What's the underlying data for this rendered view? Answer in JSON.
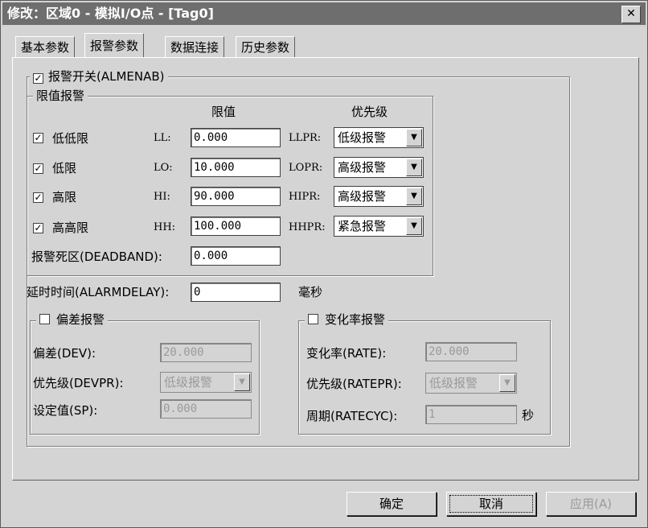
{
  "window": {
    "title": "修改：区域0 - 模拟I/O点 - [Tag0]",
    "close": "✕"
  },
  "tabs": [
    "基本参数",
    "报警参数",
    "数据连接",
    "历史参数"
  ],
  "alarm_switch": {
    "label": "报警开关(ALMENAB)",
    "checked": "✓"
  },
  "limit_group": {
    "title": "限值报警",
    "col_limit": "限值",
    "col_priority": "优先级",
    "rows": [
      {
        "check": "✓",
        "name": "低低限",
        "code": "LL:",
        "value": "0.000",
        "pr_code": "LLPR:",
        "priority": "低级报警"
      },
      {
        "check": "✓",
        "name": "低限",
        "code": "LO:",
        "value": "10.000",
        "pr_code": "LOPR:",
        "priority": "高级报警"
      },
      {
        "check": "✓",
        "name": "高限",
        "code": "HI:",
        "value": "90.000",
        "pr_code": "HIPR:",
        "priority": "高级报警"
      },
      {
        "check": "✓",
        "name": "高高限",
        "code": "HH:",
        "value": "100.000",
        "pr_code": "HHPR:",
        "priority": "紧急报警"
      }
    ],
    "deadband_label": "报警死区(DEADBAND):",
    "deadband_value": "0.000"
  },
  "delay": {
    "label": "延时时间(ALARMDELAY):",
    "value": "0",
    "unit": "毫秒"
  },
  "deviation_group": {
    "title": "偏差报警",
    "dev_label": "偏差(DEV):",
    "dev_value": "20.000",
    "pr_label": "优先级(DEVPR):",
    "pr_value": "低级报警",
    "sp_label": "设定值(SP):",
    "sp_value": "0.000"
  },
  "rate_group": {
    "title": "变化率报警",
    "rate_label": "变化率(RATE):",
    "rate_value": "20.000",
    "pr_label": "优先级(RATEPR):",
    "pr_value": "低级报警",
    "cyc_label": "周期(RATECYC):",
    "cyc_value": "1",
    "cyc_unit": "秒"
  },
  "buttons": {
    "ok": "确定",
    "cancel": "取消",
    "apply": "应用(A)"
  },
  "icons": {
    "dropdown_arrow": "▼"
  }
}
